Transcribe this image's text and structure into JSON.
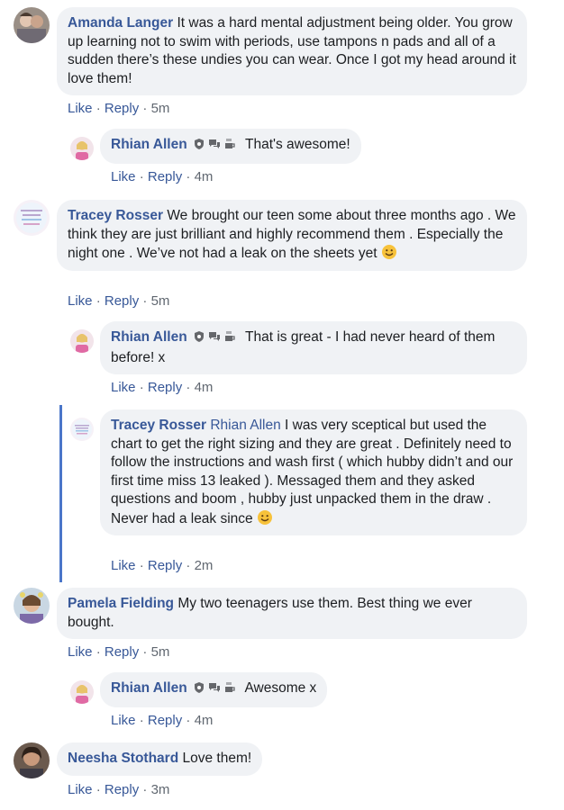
{
  "actions": {
    "like": "Like",
    "reply": "Reply",
    "separator": "·"
  },
  "comments": [
    {
      "author": "Amanda Langer",
      "text": "It was a hard mental adjustment being older. You grow up learning not to swim with periods, use tampons n pads and all of a sudden there’s these undies you can wear. Once I got my head around it love them!",
      "time": "5m"
    },
    {
      "author": "Rhian Allen",
      "text": "That's awesome!",
      "time": "4m"
    },
    {
      "author": "Tracey Rosser",
      "text": "We brought our teen some about three months ago . We think they are just brilliant and highly recommend them . Especially the night one . We’ve not had a leak on the sheets yet",
      "time": "5m"
    },
    {
      "author": "Rhian Allen",
      "text": "That is great - I had never heard of them before! x",
      "time": "4m"
    },
    {
      "author": "Tracey Rosser",
      "mention": "Rhian Allen",
      "text_lines": [
        "I was very sceptical but used the chart to get the right sizing and they are great . Definitely need to follow the instructions and wash first ( which hubby didn’t and our first time miss 13 leaked ). Messaged them and they asked questions and boom , hubby just unpacked them in the draw .",
        "Never had a leak since"
      ],
      "time": "2m"
    },
    {
      "author": "Pamela Fielding",
      "text": "My two teenagers use them. Best thing we ever bought.",
      "time": "5m"
    },
    {
      "author": "Rhian Allen",
      "text": "Awesome x",
      "time": "4m"
    },
    {
      "author": "Neesha Stothard",
      "text": "Love them!",
      "time": "3m"
    }
  ],
  "icons": {
    "badge_1": "admin-shield-icon",
    "badge_2": "chat-bubbles-icon",
    "badge_3": "coffee-cup-icon",
    "emoji": "smiling-face-emoji"
  },
  "colors": {
    "link": "#385898",
    "bubble": "#f0f2f5",
    "thread": "#4a76c9",
    "meta": "#606770"
  }
}
